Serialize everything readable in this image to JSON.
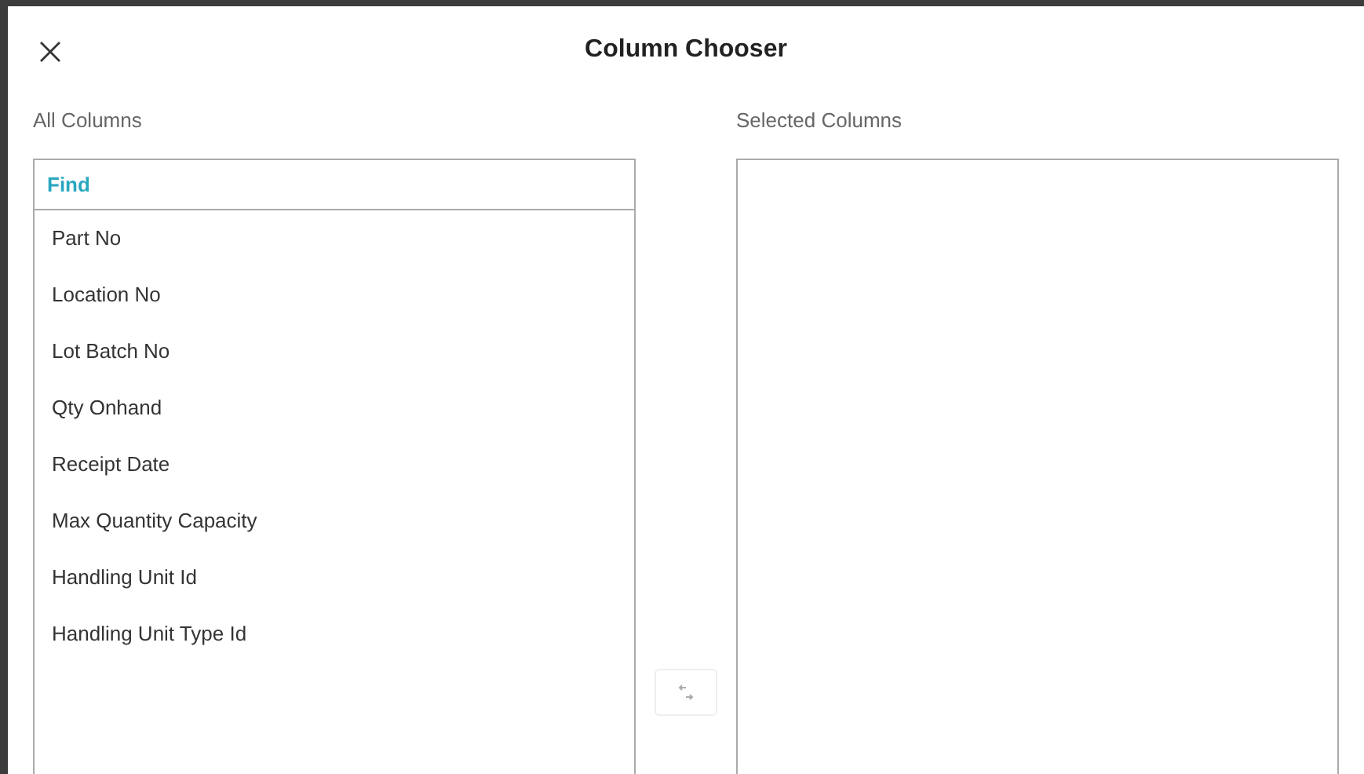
{
  "dialog": {
    "title": "Column Chooser"
  },
  "all_columns": {
    "label": "All Columns",
    "search": {
      "placeholder": "Find"
    },
    "items": [
      {
        "label": "Part No",
        "selected": false
      },
      {
        "label": "Location No",
        "selected": false
      },
      {
        "label": "Lot Batch No",
        "selected": false
      },
      {
        "label": "Qty Onhand",
        "selected": false
      },
      {
        "label": "Receipt Date",
        "selected": false
      },
      {
        "label": "Max Quantity Capacity",
        "selected": false
      },
      {
        "label": "Handling Unit Id",
        "selected": false
      },
      {
        "label": "Handling Unit Type Id",
        "selected": false
      }
    ]
  },
  "move_button": {
    "disabled": true
  },
  "selected_columns": {
    "label": "Selected Columns"
  }
}
